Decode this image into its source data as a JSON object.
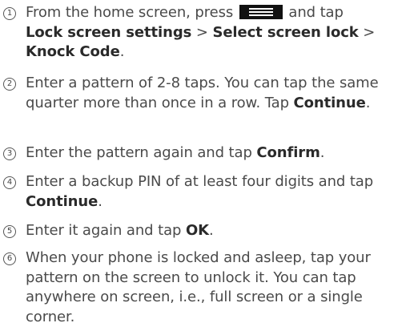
{
  "steps": [
    {
      "number": "1",
      "t1": "From the home screen, press ",
      "icon": "menu-icon",
      "t2": " and tap ",
      "b1": "Lock screen settings",
      "sep1": " > ",
      "b2": "Select screen lock",
      "sep2": " > ",
      "b3": "Knock Code",
      "end": "."
    },
    {
      "number": "2",
      "text": "Enter a pattern of 2-8 taps. You can tap the same quarter more than once in a row. Tap ",
      "bold": "Continue",
      "end": "."
    },
    {
      "number": "3",
      "text": "Enter the pattern again and tap ",
      "bold": "Confirm",
      "end": "."
    },
    {
      "number": "4",
      "text": "Enter a backup PIN of at least four digits and tap ",
      "bold": "Continue",
      "end": "."
    },
    {
      "number": "5",
      "text": "Enter it again and tap ",
      "bold": "OK",
      "end": "."
    },
    {
      "number": "6",
      "text": "When your phone is locked and asleep, tap your pattern on the screen to unlock it. You can tap anywhere on screen, i.e., full screen or a single corner."
    }
  ]
}
